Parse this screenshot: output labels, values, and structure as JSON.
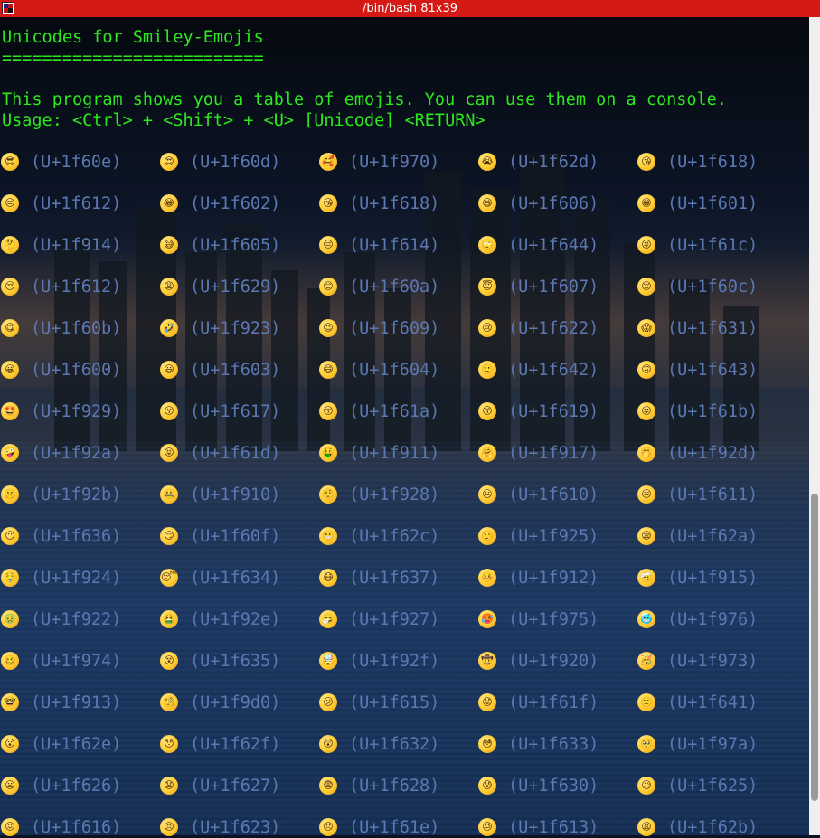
{
  "window": {
    "title": "/bin/bash 81x39"
  },
  "heading": {
    "title": "Unicodes for Smiley-Emojis",
    "underline": "==========================",
    "description": "This program shows you a table of emojis. You can use them on a console.",
    "usage": "Usage: <Ctrl> + <Shift> + <U> [Unicode] <RETURN>"
  },
  "emoji_table": {
    "rows": [
      [
        {
          "glyph": "😎",
          "code": "(U+1f60e)"
        },
        {
          "glyph": "😍",
          "code": "(U+1f60d)"
        },
        {
          "glyph": "🥰",
          "code": "(U+1f970)"
        },
        {
          "glyph": "😭",
          "code": "(U+1f62d)"
        },
        {
          "glyph": "😘",
          "code": "(U+1f618)"
        }
      ],
      [
        {
          "glyph": "😒",
          "code": "(U+1f612)"
        },
        {
          "glyph": "😂",
          "code": "(U+1f602)"
        },
        {
          "glyph": "😘",
          "code": "(U+1f618)"
        },
        {
          "glyph": "😆",
          "code": "(U+1f606)"
        },
        {
          "glyph": "😁",
          "code": "(U+1f601)"
        }
      ],
      [
        {
          "glyph": "🤔",
          "code": "(U+1f914)"
        },
        {
          "glyph": "😅",
          "code": "(U+1f605)"
        },
        {
          "glyph": "😔",
          "code": "(U+1f614)"
        },
        {
          "glyph": "🙄",
          "code": "(U+1f644)"
        },
        {
          "glyph": "😜",
          "code": "(U+1f61c)"
        }
      ],
      [
        {
          "glyph": "😒",
          "code": "(U+1f612)"
        },
        {
          "glyph": "😩",
          "code": "(U+1f629)"
        },
        {
          "glyph": "😊",
          "code": "(U+1f60a)"
        },
        {
          "glyph": "😇",
          "code": "(U+1f607)"
        },
        {
          "glyph": "😌",
          "code": "(U+1f60c)"
        }
      ],
      [
        {
          "glyph": "😋",
          "code": "(U+1f60b)"
        },
        {
          "glyph": "🤣",
          "code": "(U+1f923)"
        },
        {
          "glyph": "😉",
          "code": "(U+1f609)"
        },
        {
          "glyph": "😢",
          "code": "(U+1f622)"
        },
        {
          "glyph": "😱",
          "code": "(U+1f631)"
        }
      ],
      [
        {
          "glyph": "😀",
          "code": "(U+1f600)"
        },
        {
          "glyph": "😃",
          "code": "(U+1f603)"
        },
        {
          "glyph": "😄",
          "code": "(U+1f604)"
        },
        {
          "glyph": "🙂",
          "code": "(U+1f642)"
        },
        {
          "glyph": "🙃",
          "code": "(U+1f643)"
        }
      ],
      [
        {
          "glyph": "🤩",
          "code": "(U+1f929)"
        },
        {
          "glyph": "😗",
          "code": "(U+1f617)"
        },
        {
          "glyph": "😚",
          "code": "(U+1f61a)"
        },
        {
          "glyph": "😙",
          "code": "(U+1f619)"
        },
        {
          "glyph": "😛",
          "code": "(U+1f61b)"
        }
      ],
      [
        {
          "glyph": "🤪",
          "code": "(U+1f92a)"
        },
        {
          "glyph": "😝",
          "code": "(U+1f61d)"
        },
        {
          "glyph": "🤑",
          "code": "(U+1f911)"
        },
        {
          "glyph": "🤗",
          "code": "(U+1f917)"
        },
        {
          "glyph": "🤭",
          "code": "(U+1f92d)"
        }
      ],
      [
        {
          "glyph": "🤫",
          "code": "(U+1f92b)"
        },
        {
          "glyph": "🤐",
          "code": "(U+1f910)"
        },
        {
          "glyph": "🤨",
          "code": "(U+1f928)"
        },
        {
          "glyph": "😐",
          "code": "(U+1f610)"
        },
        {
          "glyph": "😑",
          "code": "(U+1f611)"
        }
      ],
      [
        {
          "glyph": "😶",
          "code": "(U+1f636)"
        },
        {
          "glyph": "😏",
          "code": "(U+1f60f)"
        },
        {
          "glyph": "😬",
          "code": "(U+1f62c)"
        },
        {
          "glyph": "🤥",
          "code": "(U+1f925)"
        },
        {
          "glyph": "😪",
          "code": "(U+1f62a)"
        }
      ],
      [
        {
          "glyph": "🤤",
          "code": "(U+1f924)"
        },
        {
          "glyph": "😴",
          "code": "(U+1f634)"
        },
        {
          "glyph": "😷",
          "code": "(U+1f637)"
        },
        {
          "glyph": "🤒",
          "code": "(U+1f912)"
        },
        {
          "glyph": "🤕",
          "code": "(U+1f915)"
        }
      ],
      [
        {
          "glyph": "🤢",
          "code": "(U+1f922)"
        },
        {
          "glyph": "🤮",
          "code": "(U+1f92e)"
        },
        {
          "glyph": "🤧",
          "code": "(U+1f927)"
        },
        {
          "glyph": "🥵",
          "code": "(U+1f975)"
        },
        {
          "glyph": "🥶",
          "code": "(U+1f976)"
        }
      ],
      [
        {
          "glyph": "🥴",
          "code": "(U+1f974)"
        },
        {
          "glyph": "😵",
          "code": "(U+1f635)"
        },
        {
          "glyph": "🤯",
          "code": "(U+1f92f)"
        },
        {
          "glyph": "🤠",
          "code": "(U+1f920)"
        },
        {
          "glyph": "🥳",
          "code": "(U+1f973)"
        }
      ],
      [
        {
          "glyph": "🤓",
          "code": "(U+1f913)"
        },
        {
          "glyph": "🧐",
          "code": "(U+1f9d0)"
        },
        {
          "glyph": "😕",
          "code": "(U+1f615)"
        },
        {
          "glyph": "😟",
          "code": "(U+1f61f)"
        },
        {
          "glyph": "🙁",
          "code": "(U+1f641)"
        }
      ],
      [
        {
          "glyph": "😮",
          "code": "(U+1f62e)"
        },
        {
          "glyph": "😯",
          "code": "(U+1f62f)"
        },
        {
          "glyph": "😲",
          "code": "(U+1f632)"
        },
        {
          "glyph": "😳",
          "code": "(U+1f633)"
        },
        {
          "glyph": "🥺",
          "code": "(U+1f97a)"
        }
      ],
      [
        {
          "glyph": "😦",
          "code": "(U+1f626)"
        },
        {
          "glyph": "😧",
          "code": "(U+1f627)"
        },
        {
          "glyph": "😨",
          "code": "(U+1f628)"
        },
        {
          "glyph": "😰",
          "code": "(U+1f630)"
        },
        {
          "glyph": "😥",
          "code": "(U+1f625)"
        }
      ],
      [
        {
          "glyph": "😖",
          "code": "(U+1f616)"
        },
        {
          "glyph": "😣",
          "code": "(U+1f623)"
        },
        {
          "glyph": "😞",
          "code": "(U+1f61e)"
        },
        {
          "glyph": "😓",
          "code": "(U+1f613)"
        },
        {
          "glyph": "😫",
          "code": "(U+1f62b)"
        }
      ]
    ]
  },
  "colors": {
    "titlebar": "#d51a16",
    "text_green": "#2ee81e",
    "code_blue": "#5b78b3",
    "scrollbar": "#efefef"
  }
}
